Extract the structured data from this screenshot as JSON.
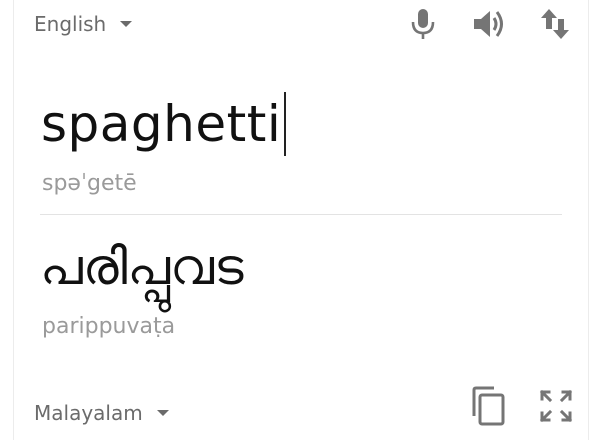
{
  "source": {
    "language": "English",
    "text": "spaghetti",
    "transliteration": "spəˈgetē"
  },
  "target": {
    "language": "Malayalam",
    "text": "പരിപ്പുവട",
    "transliteration": "parippuvaṭa"
  },
  "icons": {
    "mic": "mic-icon",
    "speaker": "speaker-icon",
    "swap": "swap-languages-icon",
    "copy": "copy-icon",
    "fullscreen": "fullscreen-icon",
    "caret": "caret-down-icon"
  },
  "colors": {
    "icon": "#757575",
    "text": "#111111",
    "secondary_text": "#9a9a9a"
  }
}
